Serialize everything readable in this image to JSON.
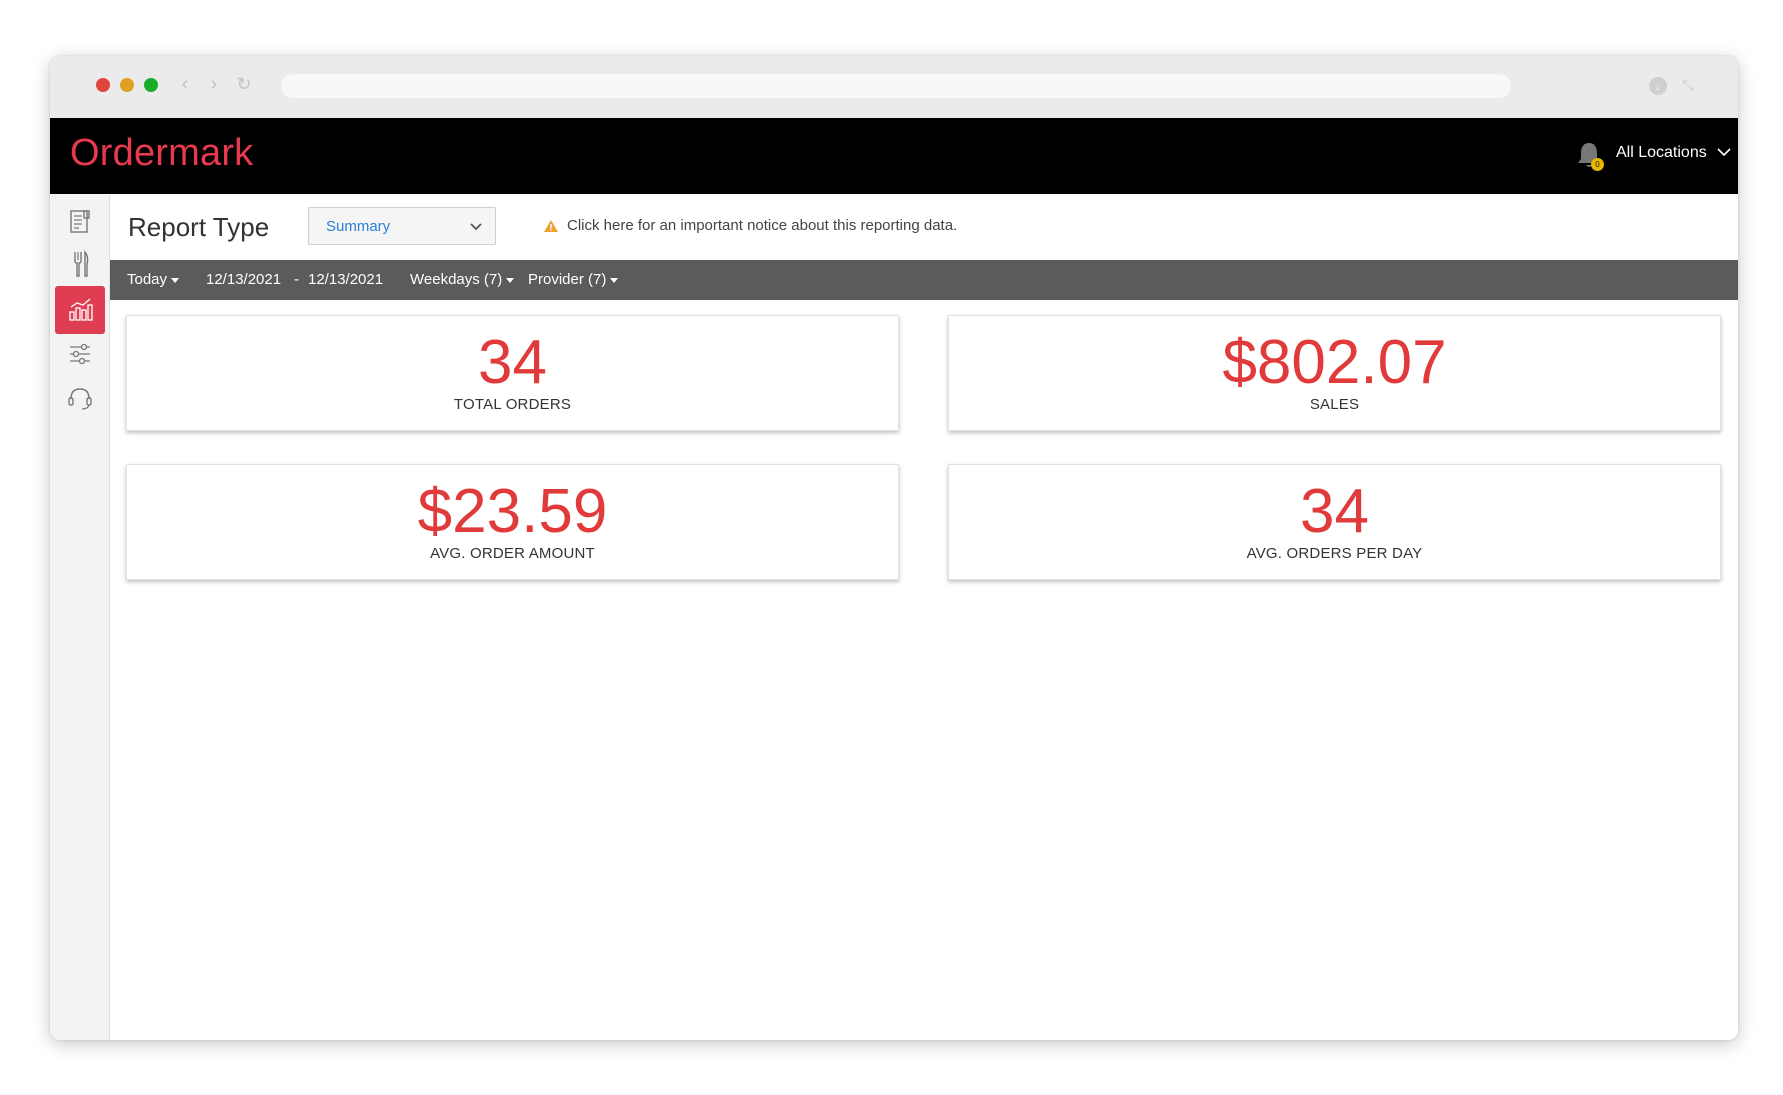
{
  "app": {
    "brand": "Ordermark"
  },
  "header": {
    "locations_label": "All Locations",
    "notification_count": "0"
  },
  "sidebar": {
    "items": [
      {
        "icon": "receipt-icon"
      },
      {
        "icon": "fork-knife-icon"
      },
      {
        "icon": "analytics-icon",
        "active": true
      },
      {
        "icon": "sliders-icon"
      },
      {
        "icon": "support-headset-icon"
      }
    ]
  },
  "report": {
    "title": "Report Type",
    "type_value": "Summary",
    "notice": "Click here for an important notice about this reporting data."
  },
  "filters": {
    "period": "Today",
    "start_date": "12/13/2021",
    "separator": "-",
    "end_date": "12/13/2021",
    "weekdays": "Weekdays (7)",
    "provider": "Provider (7)"
  },
  "metrics": [
    {
      "value": "34",
      "label": "TOTAL ORDERS"
    },
    {
      "value": "$802.07",
      "label": "SALES"
    },
    {
      "value": "$23.59",
      "label": "AVG. ORDER AMOUNT"
    },
    {
      "value": "34",
      "label": "AVG. ORDERS PER DAY"
    }
  ],
  "colors": {
    "brand": "#e8394f",
    "metric": "#e03a3a",
    "filterbar": "#5b5b5b",
    "link": "#2a7fd4",
    "warning": "#f0a030"
  }
}
